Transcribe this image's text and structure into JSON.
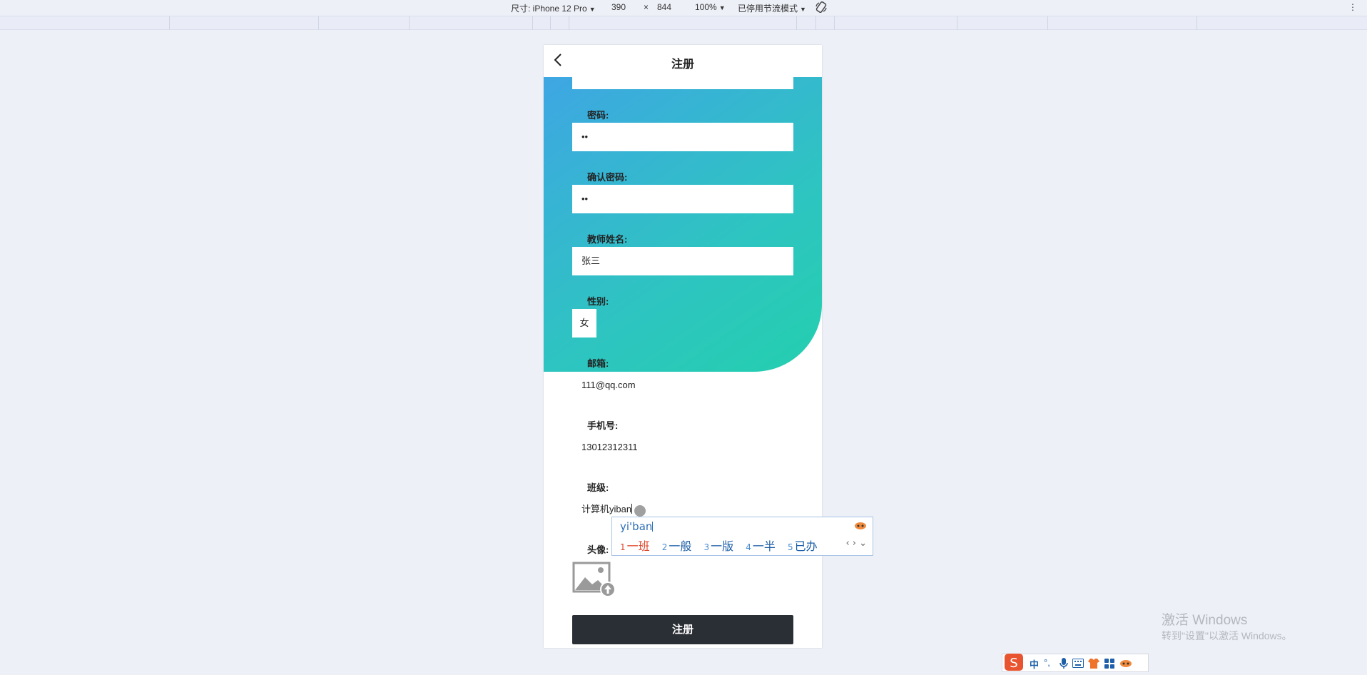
{
  "devtools": {
    "device_label": "尺寸: iPhone 12 Pro",
    "width": "390",
    "times": "×",
    "height": "844",
    "zoom": "100%",
    "throttle": "已停用节流模式",
    "more": "⋮"
  },
  "app": {
    "title": "注册",
    "fields": {
      "password_label": "密码:",
      "password_value": "••",
      "confirm_label": "确认密码:",
      "confirm_value": "••",
      "teacher_label": "教师姓名:",
      "teacher_value": "张三",
      "gender_label": "性别:",
      "gender_value": "女",
      "email_label": "邮箱:",
      "email_value": "111@qq.com",
      "phone_label": "手机号:",
      "phone_value": "13012312311",
      "class_label": "班级:",
      "class_value": "计算机yiban",
      "avatar_label": "头像:"
    },
    "submit": "注册"
  },
  "ime": {
    "composition": "yi'ban",
    "candidates": [
      {
        "n": "1",
        "text": "一班"
      },
      {
        "n": "2",
        "text": "一般"
      },
      {
        "n": "3",
        "text": "一版"
      },
      {
        "n": "4",
        "text": "一半"
      },
      {
        "n": "5",
        "text": "已办"
      }
    ],
    "nav": "‹ › ⌄"
  },
  "watermark": {
    "line1": "激活 Windows",
    "line2": "转到\"设置\"以激活 Windows。"
  },
  "tray": {
    "lang": "中",
    "punct": "°,"
  }
}
